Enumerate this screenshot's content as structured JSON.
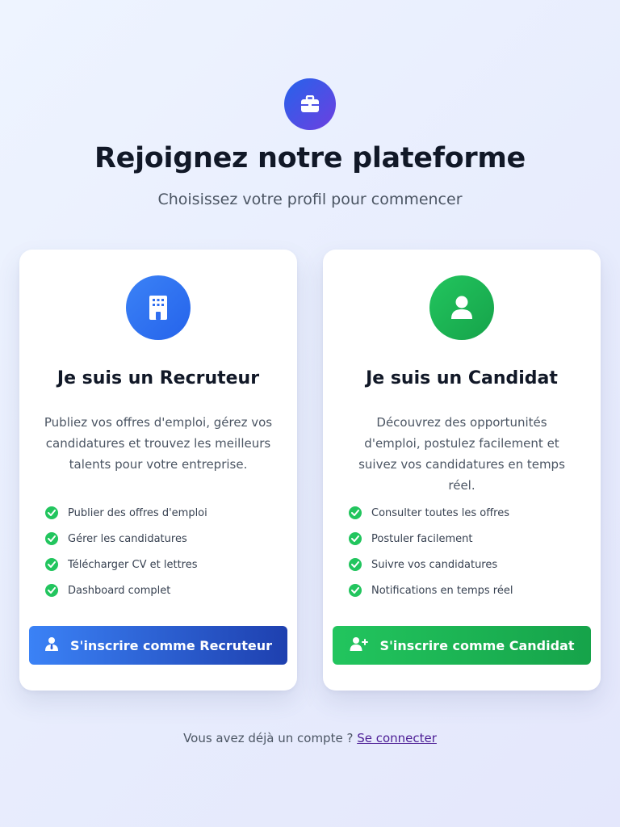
{
  "header": {
    "icon": "briefcase-icon",
    "title": "Rejoignez notre plateforme",
    "subtitle": "Choisissez votre profil pour commencer"
  },
  "cards": [
    {
      "icon": "building-icon",
      "title": "Je suis un Recruteur",
      "description": "Publiez vos offres d'emploi, gérez vos candidatures et trouvez les meilleurs talents pour votre entreprise.",
      "features": [
        "Publier des offres d'emploi",
        "Gérer les candidatures",
        "Télécharger CV et lettres",
        "Dashboard complet"
      ],
      "button_label": "S'inscrire comme Recruteur",
      "button_icon": "user-tie-icon",
      "accent": "#3b82f6"
    },
    {
      "icon": "user-icon",
      "title": "Je suis un Candidat",
      "description": "Découvrez des opportunités d'emploi, postulez facilement et suivez vos candidatures en temps réel.",
      "features": [
        "Consulter toutes les offres",
        "Postuler facilement",
        "Suivre vos candidatures",
        "Notifications en temps réel"
      ],
      "button_label": "S'inscrire comme Candidat",
      "button_icon": "user-plus-icon",
      "accent": "#22c55e"
    }
  ],
  "footer": {
    "prompt": "Vous avez déjà un compte ?",
    "link_label": "Se connecter"
  },
  "colors": {
    "check": "#22c55e",
    "link": "#4c1d95"
  }
}
